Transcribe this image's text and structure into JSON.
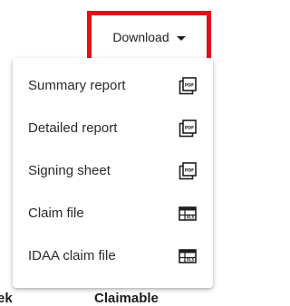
{
  "toolbar": {
    "download_label": "Download"
  },
  "table": {
    "header_left": "ek",
    "header_right": "Claimable"
  },
  "menu": {
    "items": [
      {
        "label": "Summary report",
        "icon": "pdf-icon"
      },
      {
        "label": "Detailed report",
        "icon": "pdf-icon"
      },
      {
        "label": "Signing sheet",
        "icon": "pdf-icon"
      },
      {
        "label": "Claim file",
        "icon": "spreadsheet-icon"
      },
      {
        "label": "IDAA claim file",
        "icon": "spreadsheet-icon"
      }
    ]
  },
  "colors": {
    "highlight": "#e3101c",
    "text": "#2b2b2b"
  }
}
